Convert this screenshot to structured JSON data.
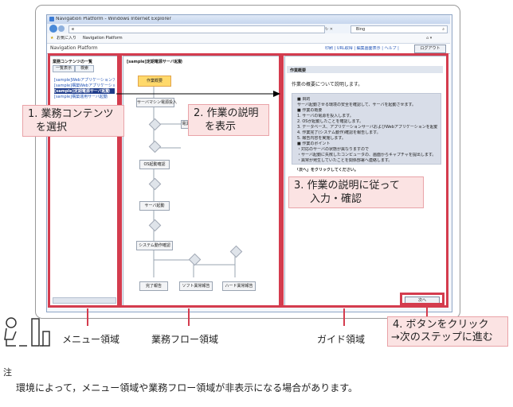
{
  "browser": {
    "title": "Navigation Platform - Windows Internet Explorer",
    "address": "e",
    "search_text": "Bing",
    "favorites_label": "お気に入り",
    "tab_label": "Navigation Platform"
  },
  "app": {
    "name": "Navigation Platform",
    "header_links": "印刷 | URL取得 | 編集画面表示 | ヘルプ |",
    "logout_label": "ログアウト"
  },
  "menu": {
    "title": "業務コンテンツの一覧",
    "tabs": [
      "一覧表示",
      "検索"
    ],
    "items": [
      "[sample]Webアプリケーションアップ",
      "[sample]構築Webアプリケーションアップ",
      "[sample]定期電源サーバ起動",
      "[sample]構築運用サーバ起動"
    ]
  },
  "flow": {
    "title": "[sample]定期電源サーバ起動",
    "nodes": [
      "作業概要",
      "サーバマシン電源投入",
      "電源プ",
      "OS起動確認",
      "サーバ起動",
      "システム動作確認",
      "完了報告",
      "ソフト異常報告",
      "ハード異常報告"
    ]
  },
  "guide": {
    "heading": "作業概要",
    "intro": "作業の概要について説明します。",
    "box_lines": [
      "■ 目的",
      "サーバ起動させる環境の安全を確認して、サーバを起動させます。",
      "■ 作業の概要",
      "1. サーバの電源を投入します。",
      "2. OSが起動したことを確認します。",
      "3. データベース、アプリケーションサーバおよびWebアプリケーションを起動します。",
      "4. 作業完了(システム動作)確認を報告します。",
      "5. 報告内容を実施します。",
      "■ 作業のポイント",
      "・対応のサーバの状態が異なりますので",
      "・サーバ起動に失敗したコンピュータの、画面からキャプチャを提出します。",
      "・異常が発生していたことを関係部署へ連絡します。"
    ],
    "next_hint": "「次へ」をクリックしてください。",
    "next_button": "次へ"
  },
  "callouts": {
    "c1": [
      "1. 業務コンテンツ",
      "を選択"
    ],
    "c2": [
      "2. 作業の説明",
      "を表示"
    ],
    "c3": [
      "3. 作業の説明に従って",
      "入力・確認"
    ],
    "c4": [
      "4. ボタンをクリック",
      "→次のステップに進む"
    ]
  },
  "regions": {
    "menu": "メニュー領域",
    "flow": "業務フロー領域",
    "guide": "ガイド領域"
  },
  "note": {
    "label": "注",
    "text": "環境によって，メニュー領域や業務フロー領域が非表示になる場合があります。"
  },
  "colors": {
    "highlight_red": "#d43c4e",
    "callout_fill": "#fbe3e3",
    "start_node": "#ffd96b"
  }
}
